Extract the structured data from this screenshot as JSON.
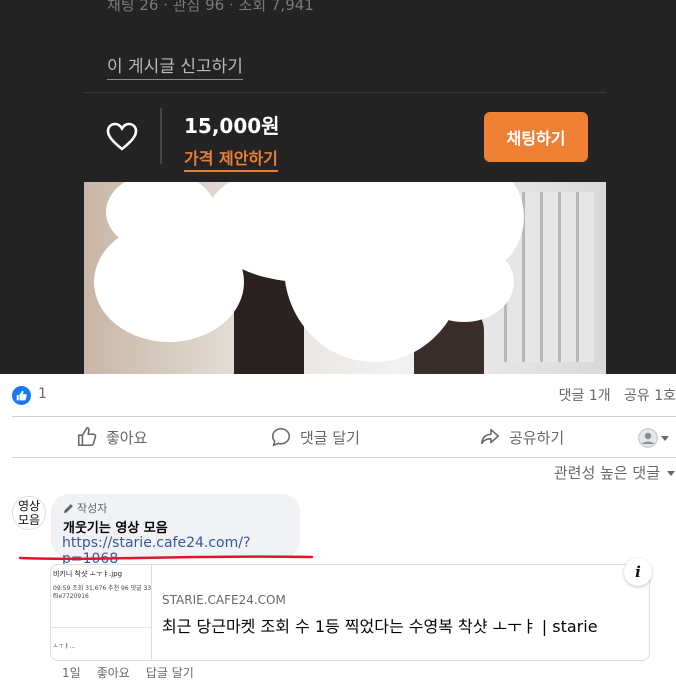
{
  "listing": {
    "stats": "채팅 26 · 관심 96 · 조회 7,941",
    "report_label": "이 게시글 신고하기",
    "price": "15,000원",
    "price_offer_label": "가격 제안하기",
    "chat_button": "채팅하기"
  },
  "post": {
    "like_count": "1",
    "comments_count": "댓글 1개",
    "shares_count": "공유 1호",
    "actions": {
      "like": "좋아요",
      "comment": "댓글 달기",
      "share": "공유하기"
    },
    "sort_label": "관련성 높은 댓글"
  },
  "comment": {
    "avatar_text": "영상\n모음",
    "author_badge": "작성자",
    "title": "개웃기는 영상 모음",
    "link": "https://starie.cafe24.com/?p=1068",
    "preview": {
      "domain": "STARIE.CAFE24.COM",
      "title": "최근 당근마켓 조회 수 1등 찍었다는 수영복 착샷 ㅗㅜㅑ | starie",
      "thumb_title": "비키니 착샷 ㅗㅜㅑ.jpg",
      "thumb_stats": "09:59  조회 31,676  추천 96  댓글 33",
      "thumb_id": "file7720916",
      "thumb_foot": "ㅗㅜㅑ..."
    },
    "meta": {
      "time": "1일",
      "like": "좋아요",
      "reply": "답글 달기"
    }
  },
  "colors": {
    "accent_orange": "#ee8034",
    "fb_blue": "#1877f2",
    "link_blue": "#385898",
    "underline_red": "#e0162b"
  }
}
